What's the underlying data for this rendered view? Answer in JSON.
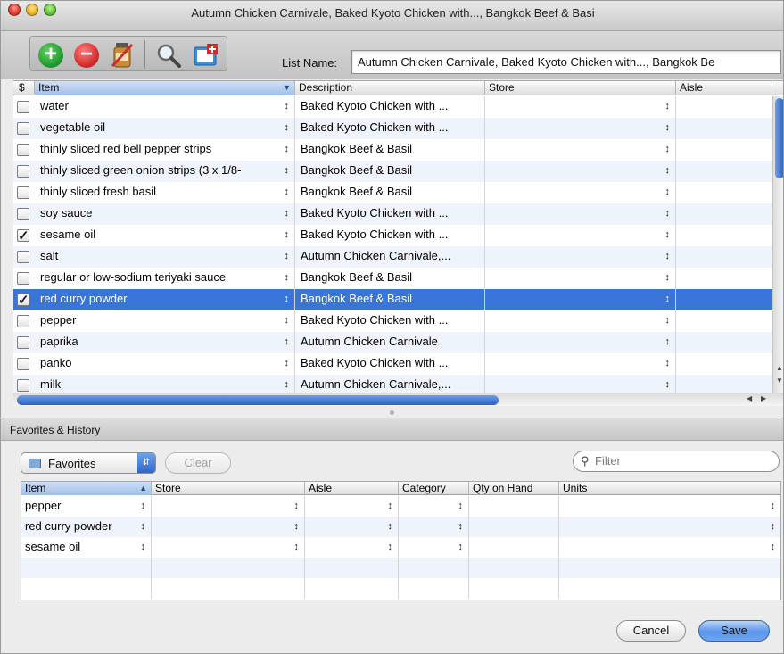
{
  "window": {
    "title": "Autumn Chicken Carnivale, Baked Kyoto Chicken with..., Bangkok Beef & Basi"
  },
  "toolbar": {
    "buttons": [
      {
        "icon": "plus-circle-icon"
      },
      {
        "icon": "minus-circle-icon"
      },
      {
        "icon": "jar-icon"
      },
      {
        "icon": "magnify-icon"
      },
      {
        "icon": "export-icon"
      }
    ],
    "list_name_label": "List Name:",
    "list_name_value": "Autumn Chicken Carnivale, Baked Kyoto Chicken with..., Bangkok Be"
  },
  "main_table": {
    "columns": [
      "$",
      "Item",
      "Description",
      "Store",
      "Aisle"
    ],
    "sorted_column": "Item",
    "rows": [
      {
        "checked": false,
        "item": "water",
        "description": "Baked Kyoto Chicken with ...",
        "store": "",
        "aisle": ""
      },
      {
        "checked": false,
        "item": "vegetable oil",
        "description": "Baked Kyoto Chicken with ...",
        "store": "",
        "aisle": ""
      },
      {
        "checked": false,
        "item": "thinly sliced red bell pepper strips",
        "description": "Bangkok Beef & Basil",
        "store": "",
        "aisle": ""
      },
      {
        "checked": false,
        "item": "thinly sliced green onion strips (3 x 1/8-",
        "description": "Bangkok Beef & Basil",
        "store": "",
        "aisle": ""
      },
      {
        "checked": false,
        "item": "thinly sliced fresh basil",
        "description": "Bangkok Beef & Basil",
        "store": "",
        "aisle": ""
      },
      {
        "checked": false,
        "item": "soy sauce",
        "description": "Baked Kyoto Chicken with ...",
        "store": "",
        "aisle": ""
      },
      {
        "checked": true,
        "item": "sesame oil",
        "description": "Baked Kyoto Chicken with ...",
        "store": "",
        "aisle": ""
      },
      {
        "checked": false,
        "item": "salt",
        "description": "Autumn Chicken Carnivale,...",
        "store": "",
        "aisle": ""
      },
      {
        "checked": false,
        "item": "regular or low-sodium teriyaki sauce",
        "description": "Bangkok Beef & Basil",
        "store": "",
        "aisle": ""
      },
      {
        "checked": true,
        "item": "red curry powder",
        "description": "Bangkok Beef & Basil",
        "store": "",
        "aisle": "",
        "selected": true
      },
      {
        "checked": false,
        "item": "pepper",
        "description": "Baked Kyoto Chicken with ...",
        "store": "",
        "aisle": ""
      },
      {
        "checked": false,
        "item": "paprika",
        "description": "Autumn Chicken Carnivale",
        "store": "",
        "aisle": ""
      },
      {
        "checked": false,
        "item": "panko",
        "description": "Baked Kyoto Chicken with ...",
        "store": "",
        "aisle": ""
      },
      {
        "checked": false,
        "item": "milk",
        "description": "Autumn Chicken Carnivale,...",
        "store": "",
        "aisle": ""
      }
    ]
  },
  "favorites": {
    "panel_title": "Favorites & History",
    "selector_value": "Favorites",
    "clear_label": "Clear",
    "filter_placeholder": "Filter",
    "columns": [
      "Item",
      "Store",
      "Aisle",
      "Category",
      "Qty on Hand",
      "Units"
    ],
    "sorted_column": "Item",
    "rows": [
      {
        "item": "pepper"
      },
      {
        "item": "red curry powder"
      },
      {
        "item": "sesame oil"
      }
    ]
  },
  "footer": {
    "cancel_label": "Cancel",
    "save_label": "Save"
  },
  "colors": {
    "selection": "#3875d7",
    "alt_row": "#eef3fc",
    "accent_blue": "#2c66cf",
    "add_green": "#1f9a2c",
    "remove_red": "#d12a2a"
  }
}
